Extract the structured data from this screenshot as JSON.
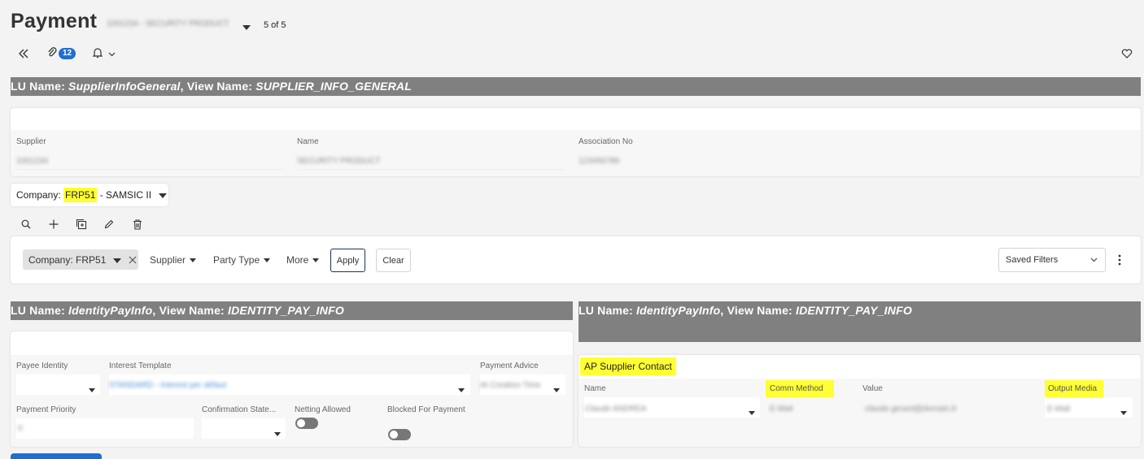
{
  "page": {
    "title": "Payment",
    "subtitle_blurred": "1001234 - SECURITY PRODUCT",
    "record_position": "5 of 5",
    "attachments_count": "12"
  },
  "header_icons": [
    "double-chevron-left-icon",
    "paperclip-icon",
    "bell-icon",
    "heart-icon"
  ],
  "lu_general": {
    "lu_prefix": "LU Name: ",
    "lu_name": "SupplierInfoGeneral",
    "view_prefix": ", View Name: ",
    "view_name": "SUPPLIER_INFO_GENERAL"
  },
  "supplier_card": {
    "fields": [
      {
        "label": "Supplier",
        "value": "1001234"
      },
      {
        "label": "Name",
        "value": "SECURITY PRODUCT"
      },
      {
        "label": "Association No",
        "value": "123456789"
      }
    ]
  },
  "company_selector": {
    "prefix": "Company: ",
    "code": "FRP51",
    "suffix": " - SAMSIC II"
  },
  "toolbar_icons": [
    "search-icon",
    "plus-icon",
    "duplicate-icon",
    "edit-icon",
    "delete-icon"
  ],
  "filters": {
    "chip_label": "Company: FRP51",
    "dropdowns": [
      "Supplier",
      "Party Type",
      "More"
    ],
    "apply_label": "Apply",
    "clear_label": "Clear",
    "saved_filters_label": "Saved Filters"
  },
  "lu_pay_left": {
    "lu_prefix": "LU Name: ",
    "lu_name": "IdentityPayInfo",
    "view_prefix": ", View Name: ",
    "view_name": "IDENTITY_PAY_INFO"
  },
  "lu_pay_right": {
    "lu_prefix": "LU Name: ",
    "lu_name": "IdentityPayInfo",
    "view_prefix": ", View Name: ",
    "view_name": "IDENTITY_PAY_INFO"
  },
  "pay_info": {
    "payee_identity_label": "Payee Identity",
    "interest_template_label": "Interest Template",
    "interest_template_value": "STANDARD - Interest per défaut",
    "payment_advice_label": "Payment Advice",
    "payment_advice_value": "At Creation Time",
    "payment_priority_label": "Payment Priority",
    "payment_priority_value": "0",
    "confirmation_label": "Confirmation State...",
    "netting_label": "Netting Allowed",
    "blocked_label": "Blocked For Payment"
  },
  "ap_contact": {
    "title": "AP Supplier Contact",
    "name_label": "Name",
    "name_value": "Claude ANDREA",
    "comm_method_label": "Comm Method",
    "comm_method_value": "E-Mail",
    "value_label": "Value",
    "value_value": "claude.gerard@domain.fr",
    "output_media_label": "Output Media",
    "output_media_value": "E-Mail"
  },
  "colors": {
    "highlight": "#ffff33",
    "lu_bar": "#808080",
    "accent": "#1f6fd1"
  }
}
